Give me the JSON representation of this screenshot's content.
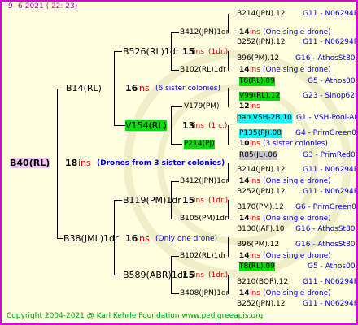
{
  "header": {
    "date": "9-  6-2021 ( 22: 23)"
  },
  "footer": {
    "copyright": "Copyright 2004-2021 @ Karl Kehrle Foundation   www.pedigreeapis.org"
  },
  "root": {
    "id": "B40(RL)",
    "count": "18",
    "ins": "ins",
    "note": "(Drones from 3 sister colonies)"
  },
  "gen1": [
    {
      "id": "B14(RL)",
      "count": "16",
      "ins": "ins",
      "note": "(6 sister colonies)"
    },
    {
      "id": "B38(JML)1dr",
      "count": "16",
      "ins": "ins",
      "note": "(Only one drone)"
    }
  ],
  "gen2": [
    {
      "id": "B526(RL)1dr",
      "count": "15",
      "ins": "ins",
      "note": "(1dr.)"
    },
    {
      "id": "V154(RL)",
      "count": "13",
      "ins": "ins",
      "note": "(1 c.)"
    },
    {
      "id": "B119(PM)1dr",
      "count": "15",
      "ins": "ins",
      "note": "(1dr.)"
    },
    {
      "id": "B589(ABR)1dr",
      "count": "15",
      "ins": "ins",
      "note": "(1dr.)"
    }
  ],
  "gen3": [
    {
      "id": "B412(JPN)1dr",
      "count": "14",
      "ins": "ins",
      "note": "(One single drone)"
    },
    {
      "id": "B102(RL)1dr",
      "count": "14",
      "ins": "ins",
      "note": "(One single drone)"
    },
    {
      "id": "V179(PM)",
      "count": "12",
      "ins": "ins",
      "note": ""
    },
    {
      "id": "P214(PJ)",
      "count": "10",
      "ins": "ins",
      "note": "(3 sister colonies)"
    },
    {
      "id": "B412(JPN)1dr",
      "count": "14",
      "ins": "ins",
      "note": "(One single drone)"
    },
    {
      "id": "B105(PM)1dr",
      "count": "14",
      "ins": "ins",
      "note": "(One single drone)"
    },
    {
      "id": "B102(RL)1dr",
      "count": "14",
      "ins": "ins",
      "note": "(One single drone)"
    },
    {
      "id": "B408(JPN)1dr",
      "count": "14",
      "ins": "ins",
      "note": "(One single drone)"
    }
  ],
  "gen4": [
    {
      "id": "B214(JPN).12",
      "code": "G11 - N06294R"
    },
    {
      "id": "B252(JPN).12",
      "code": "G11 - N06294R"
    },
    {
      "id": "B96(PM).12",
      "code": "G16 - AthosSt80R"
    },
    {
      "id": "T8(RL).09",
      "code": "G5 - Athos00R"
    },
    {
      "id": "V99(RL).12",
      "code": "G23 - Sinop62R"
    },
    {
      "id": "pap VSH-2B.10",
      "code": "G1 - VSH-Pool-AR"
    },
    {
      "id": "P135(PJ).08",
      "code": "G4 - PrimGreen00"
    },
    {
      "id": "R85(JL).06",
      "code": "G3 - PrimRed01"
    },
    {
      "id": "B214(JPN).12",
      "code": "G11 - N06294R"
    },
    {
      "id": "B252(JPN).12",
      "code": "G11 - N06294R"
    },
    {
      "id": "B170(PM).12",
      "code": "G6 - PrimGreen00"
    },
    {
      "id": "B130(JAF).10",
      "code": "G16 - AthosSt80R"
    },
    {
      "id": "B96(PM).12",
      "code": "G16 - AthosSt80R"
    },
    {
      "id": "T8(RL).09",
      "code": "G5 - Athos00R"
    },
    {
      "id": "B210(BOP).12",
      "code": "G11 - N06294R"
    },
    {
      "id": "B252(JPN).12",
      "code": "G11 - N06294R"
    }
  ]
}
